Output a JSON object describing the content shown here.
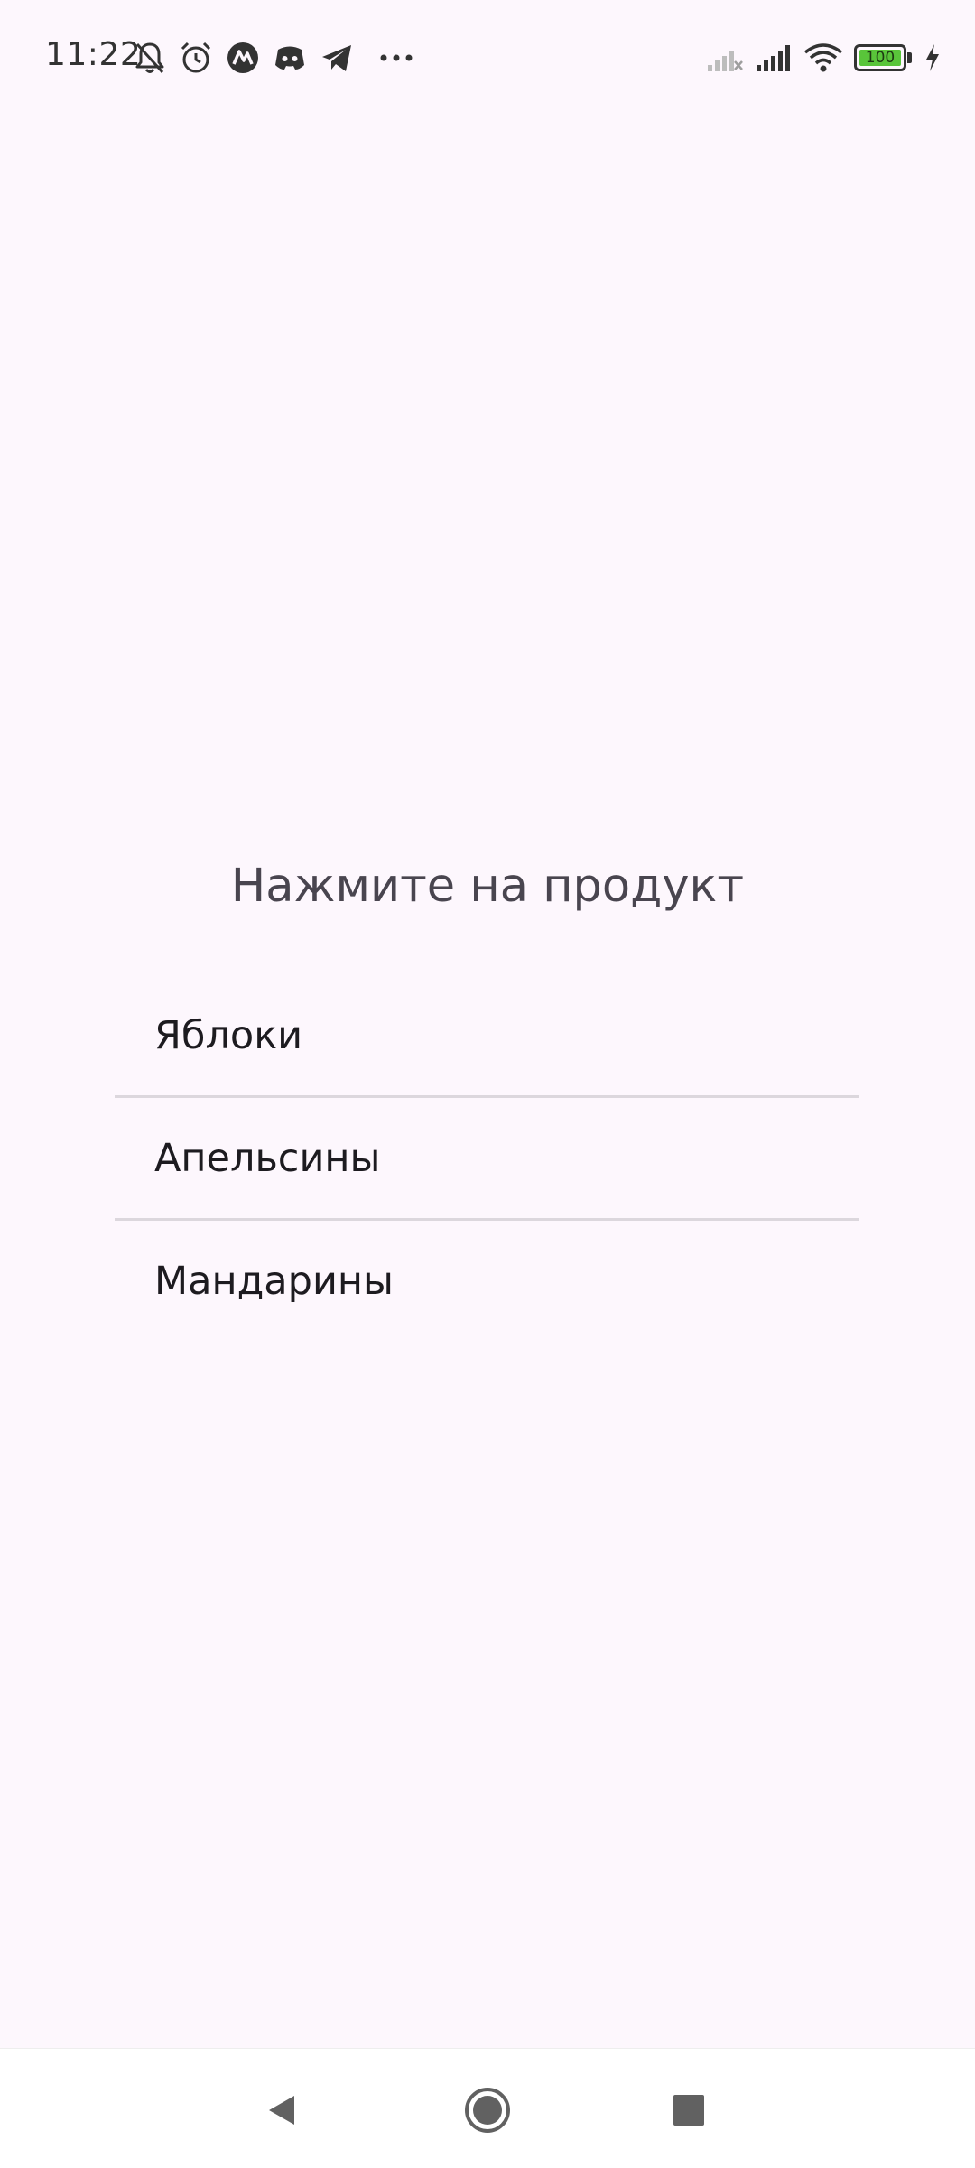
{
  "status_bar": {
    "time": "11:22",
    "notification_icons": [
      "bell-off-icon",
      "alarm-icon",
      "app-icon",
      "discord-icon",
      "telegram-icon",
      "more-dots-icon"
    ],
    "system_icons": [
      "signal-off-icon",
      "signal-icon",
      "wifi-icon",
      "battery-icon",
      "charging-icon"
    ],
    "battery_level": "100",
    "battery_color": "#59c53a"
  },
  "main": {
    "title": "Нажмите на продукт",
    "products": [
      {
        "label": "Яблоки"
      },
      {
        "label": "Апельсины"
      },
      {
        "label": "Мандарины"
      }
    ]
  },
  "nav_bar": {
    "buttons": [
      "back-icon",
      "home-icon",
      "recents-icon"
    ]
  },
  "colors": {
    "background": "#fdf7fd",
    "title_text": "#49454f",
    "item_text": "#1d1b20",
    "divider": "#dcd7dd"
  }
}
